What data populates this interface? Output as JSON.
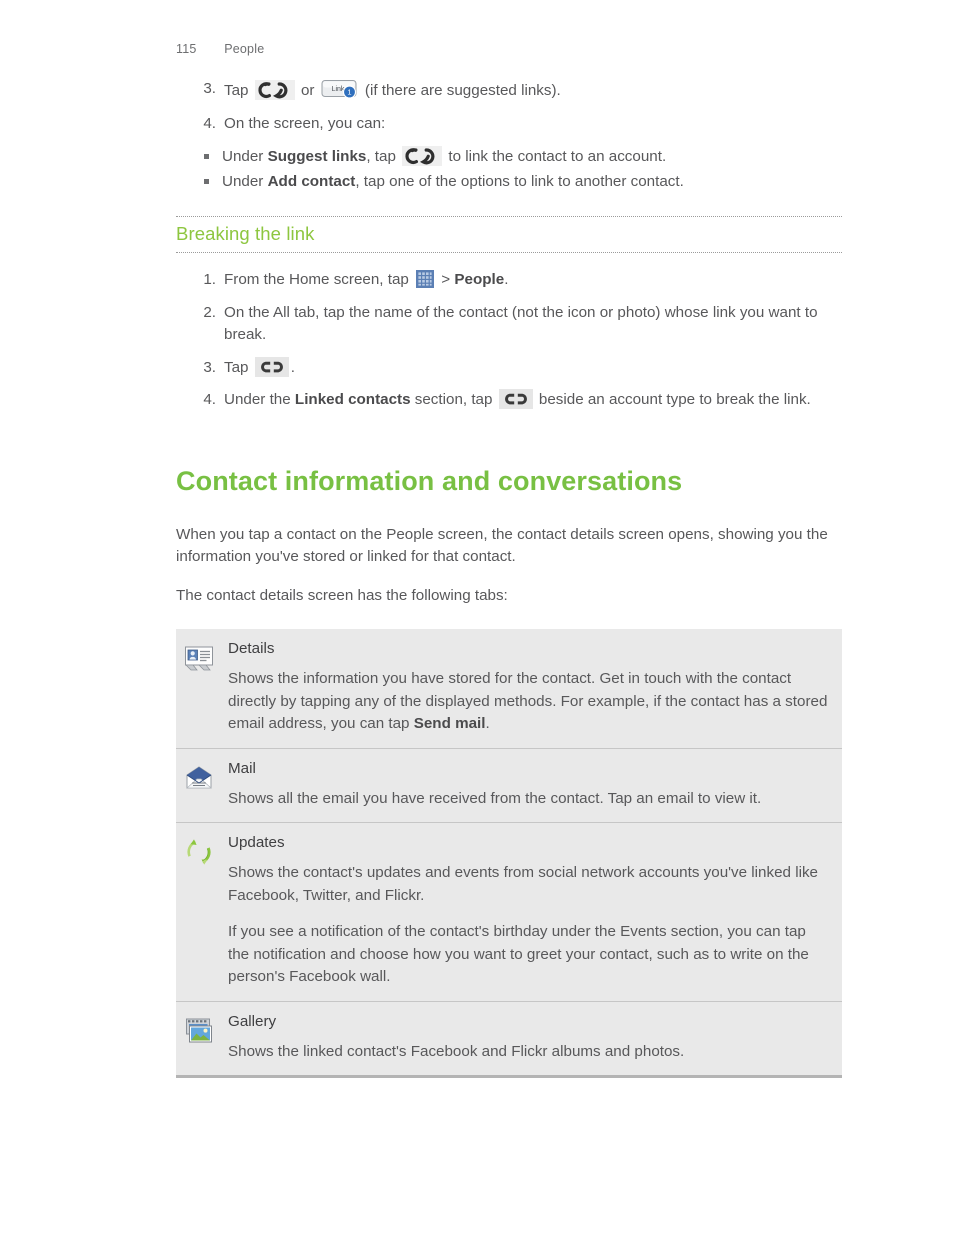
{
  "header": {
    "page_number": "115",
    "section": "People"
  },
  "colors": {
    "green_heading": "#78c043",
    "green_subheading": "#8dc63f",
    "body_text": "#58585a",
    "table_background": "#e9e9e9",
    "table_rule": "#c6c6c6",
    "badge_blue": "#2f6fbd"
  },
  "top_steps": [
    {
      "num": "3.",
      "parts": [
        {
          "type": "text",
          "value": "Tap "
        },
        {
          "type": "icon",
          "name": "link-rings-icon"
        },
        {
          "type": "text",
          "value": " or "
        },
        {
          "type": "icon",
          "name": "link-button-icon",
          "label": "Link",
          "badge": "1"
        },
        {
          "type": "text",
          "value": " (if there are suggested links)."
        }
      ],
      "plain": "Tap  or  (if there are suggested links)."
    },
    {
      "num": "4.",
      "plain": "On the screen, you can:"
    }
  ],
  "top_bullets": [
    {
      "prefix": "Under ",
      "bold": "Suggest links",
      "middle": ", tap ",
      "icon": "link-rings-icon",
      "suffix": " to link the contact to an account."
    },
    {
      "prefix": "Under ",
      "bold": "Add contact",
      "middle": ", tap one of the options to link to another contact.",
      "icon": null,
      "suffix": ""
    }
  ],
  "subheading": {
    "title": "Breaking the link"
  },
  "breaking_steps": [
    {
      "num": "1.",
      "prefix": "From the Home screen, tap ",
      "icon": "apps-grid-icon",
      "middle": " > ",
      "bold": "People",
      "suffix": "."
    },
    {
      "num": "2.",
      "prefix": "On the All tab, tap the name of the contact (not the icon or photo) whose link you want to break.",
      "icon": null,
      "middle": "",
      "bold": "",
      "suffix": ""
    },
    {
      "num": "3.",
      "prefix": "Tap ",
      "icon": "broken-link-icon",
      "middle": "",
      "bold": "",
      "suffix": "."
    },
    {
      "num": "4.",
      "prefix": "Under the ",
      "bold": "Linked contacts",
      "middle": " section, tap ",
      "icon": "broken-link-icon",
      "suffix": " beside an account type to break the link."
    }
  ],
  "main_heading": "Contact information and conversations",
  "intro_paragraphs": [
    "When you tap a contact on the People screen, the contact details screen opens, showing you the information you've stored or linked for that contact.",
    "The contact details screen has the following tabs:"
  ],
  "tabs": [
    {
      "icon": "contact-card-icon",
      "title": "Details",
      "paragraphs": [
        {
          "prefix": "Shows the information you have stored for the contact. Get in touch with the contact directly by tapping any of the displayed methods. For example, if the contact has a stored email address, you can tap ",
          "bold": "Send mail",
          "suffix": "."
        }
      ]
    },
    {
      "icon": "mail-envelope-icon",
      "title": "Mail",
      "paragraphs": [
        {
          "prefix": "Shows all the email you have received from the contact. Tap an email to view it.",
          "bold": "",
          "suffix": ""
        }
      ]
    },
    {
      "icon": "updates-refresh-icon",
      "title": "Updates",
      "paragraphs": [
        {
          "prefix": "Shows the contact's updates and events from social network accounts you've linked like Facebook, Twitter, and Flickr.",
          "bold": "",
          "suffix": ""
        },
        {
          "prefix": "If you see a notification of the contact's birthday under the Events section, you can tap the notification and choose how you want to greet your contact, such as to write on the person's Facebook wall.",
          "bold": "",
          "suffix": ""
        }
      ]
    },
    {
      "icon": "gallery-photos-icon",
      "title": "Gallery",
      "paragraphs": [
        {
          "prefix": "Shows the linked contact's Facebook and Flickr albums and photos.",
          "bold": "",
          "suffix": ""
        }
      ]
    }
  ]
}
